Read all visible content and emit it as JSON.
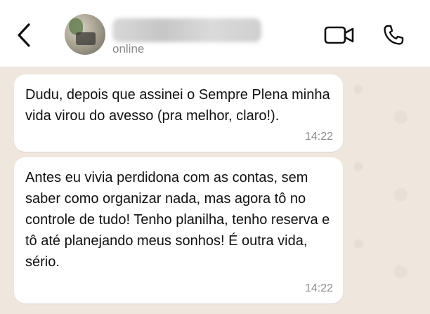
{
  "header": {
    "status": "online",
    "icons": {
      "back": "chevron-left-icon",
      "video": "video-camera-icon",
      "call": "phone-icon"
    }
  },
  "messages": [
    {
      "text": "Dudu, depois que assinei o Sempre Plena minha vida virou do avesso (pra melhor, claro!).",
      "time": "14:22"
    },
    {
      "text": "Antes eu vivia perdidona com as contas, sem saber como organizar nada, mas agora tô no controle de tudo! Tenho planilha, tenho reserva e tô até planejando meus sonhos! É outra vida, sério.",
      "time": "14:22"
    }
  ],
  "colors": {
    "chat_background": "#efe7de",
    "bubble": "#ffffff",
    "header": "#ffffff"
  }
}
